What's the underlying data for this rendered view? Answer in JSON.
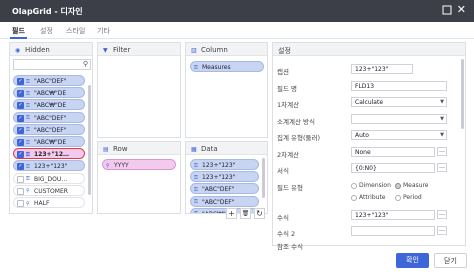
{
  "window": {
    "title": "OlapGrid - 디자인"
  },
  "tabs": [
    "필드",
    "설정",
    "스타일",
    "기타"
  ],
  "hidden_panel": {
    "title": "Hidden",
    "search_value": "",
    "items": [
      {
        "label": "\"ABC\"DEF\"",
        "checked": true,
        "style": "sel",
        "icon": "field-icon"
      },
      {
        "label": "\"ABC₩\"DE",
        "checked": true,
        "style": "sel",
        "icon": "field-icon"
      },
      {
        "label": "\"ABC₩\"DE",
        "checked": true,
        "style": "sel",
        "icon": "field-icon"
      },
      {
        "label": "\"ABC\"DEF\"",
        "checked": true,
        "style": "sel",
        "icon": "field-icon"
      },
      {
        "label": "\"ABC\"DEF\"",
        "checked": true,
        "style": "sel",
        "icon": "field-icon"
      },
      {
        "label": "\"ABC₩\"DE",
        "checked": true,
        "style": "sel",
        "icon": "field-icon"
      },
      {
        "label": "123+\"12…",
        "checked": true,
        "style": "pinkred",
        "icon": "field-icon"
      },
      {
        "label": "123+\"123\"",
        "checked": true,
        "style": "sel",
        "icon": "field-icon"
      },
      {
        "label": "BIG_DOU…",
        "checked": false,
        "style": "plain",
        "icon": "field-icon"
      },
      {
        "label": "CUSTOMER",
        "checked": false,
        "style": "plain",
        "icon": "hierarchy-icon"
      },
      {
        "label": "HALF",
        "checked": false,
        "style": "plain",
        "icon": "hierarchy-icon"
      }
    ]
  },
  "filter_panel": {
    "title": "Filter"
  },
  "column_panel": {
    "title": "Column",
    "items": [
      "Measures"
    ]
  },
  "row_panel": {
    "title": "Row",
    "items": [
      "YYYY"
    ]
  },
  "data_panel": {
    "title": "Data",
    "items": [
      "123+\"123\"",
      "123+\"123\"",
      "\"ABC\"DEF\"",
      "\"ABC\"DEF\"",
      "\"ABC₩\"DE",
      "\"ABC\"DEF\"",
      "\"ABC₩\"DE",
      "\"ABC\"DEF\""
    ]
  },
  "settings": {
    "title": "설정",
    "caption_label": "캡션",
    "caption_value": "123+\"123\"",
    "field_name_label": "필드 명",
    "field_name_value": "FLD13",
    "calc1_label": "1차계산",
    "calc1_value": "Calculate",
    "subtotal_label": "소계계산 방식",
    "subtotal_value": "",
    "agg_label": "집계 유형(둘러)",
    "agg_value": "Auto",
    "calc2_label": "2차계산",
    "calc2_value": "None",
    "format_label": "서식",
    "format_value": "{0:N0}",
    "field_type_label": "필드 유형",
    "field_type_options": [
      "Dimension",
      "Measure",
      "Attribute",
      "Period"
    ],
    "field_type_selected": "Measure",
    "formula_label": "수식",
    "formula_value": "123+\"123\"",
    "formula2_label": "수식 2",
    "formula2_value": "",
    "ref_formula_label": "참조 수식"
  },
  "toolbar": {
    "add": "+",
    "delete": "🗑",
    "refresh": "↻"
  },
  "buttons": {
    "ok": "확인",
    "cancel": "닫기"
  }
}
